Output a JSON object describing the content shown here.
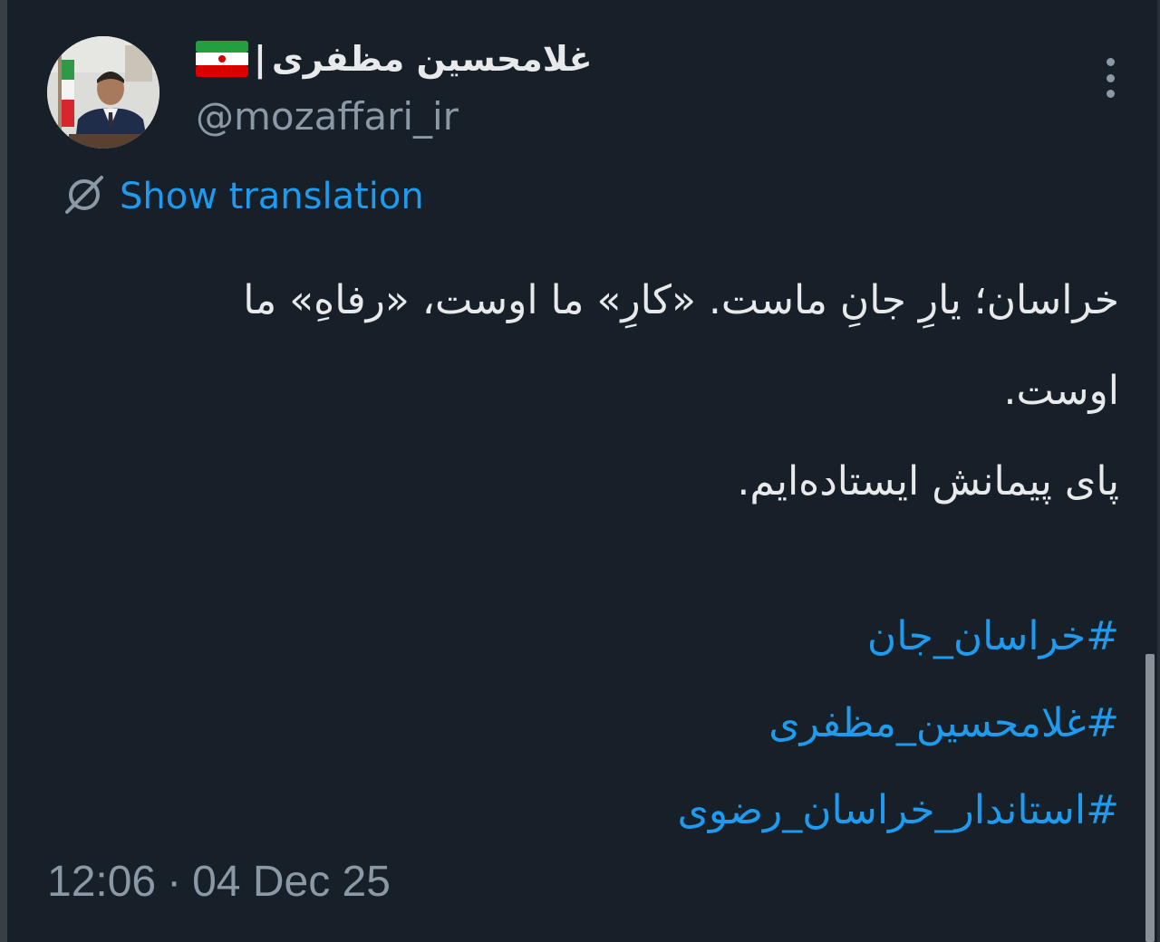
{
  "author": {
    "display_name": "غلامحسین مظفری",
    "separator": "|",
    "handle": "@mozaffari_ir",
    "avatar": "profile-photo",
    "flag": "iran-flag-emoji"
  },
  "actions": {
    "more_icon": "more-vertical-icon",
    "translate_label": "Show translation",
    "translate_icon": "translate-globe-icon"
  },
  "tweet": {
    "lines": [
      "خراسان؛ یارِ جانِ ماست. «کارِ» ما اوست، «رفاهِ» ما",
      "اوست.",
      "پای پیمانش ایستاده‌ایم."
    ],
    "hashtags": [
      "#خراسان_جان",
      "#غلامحسین_مظفری",
      "#استاندار_خراسان_رضوی"
    ]
  },
  "meta": {
    "time": "12:06",
    "dot": "·",
    "date": "04 Dec 25"
  },
  "colors": {
    "background": "#172029",
    "link": "#1d9bf0",
    "secondary_text": "#8b98a5",
    "primary_text": "#e7e9ea"
  }
}
